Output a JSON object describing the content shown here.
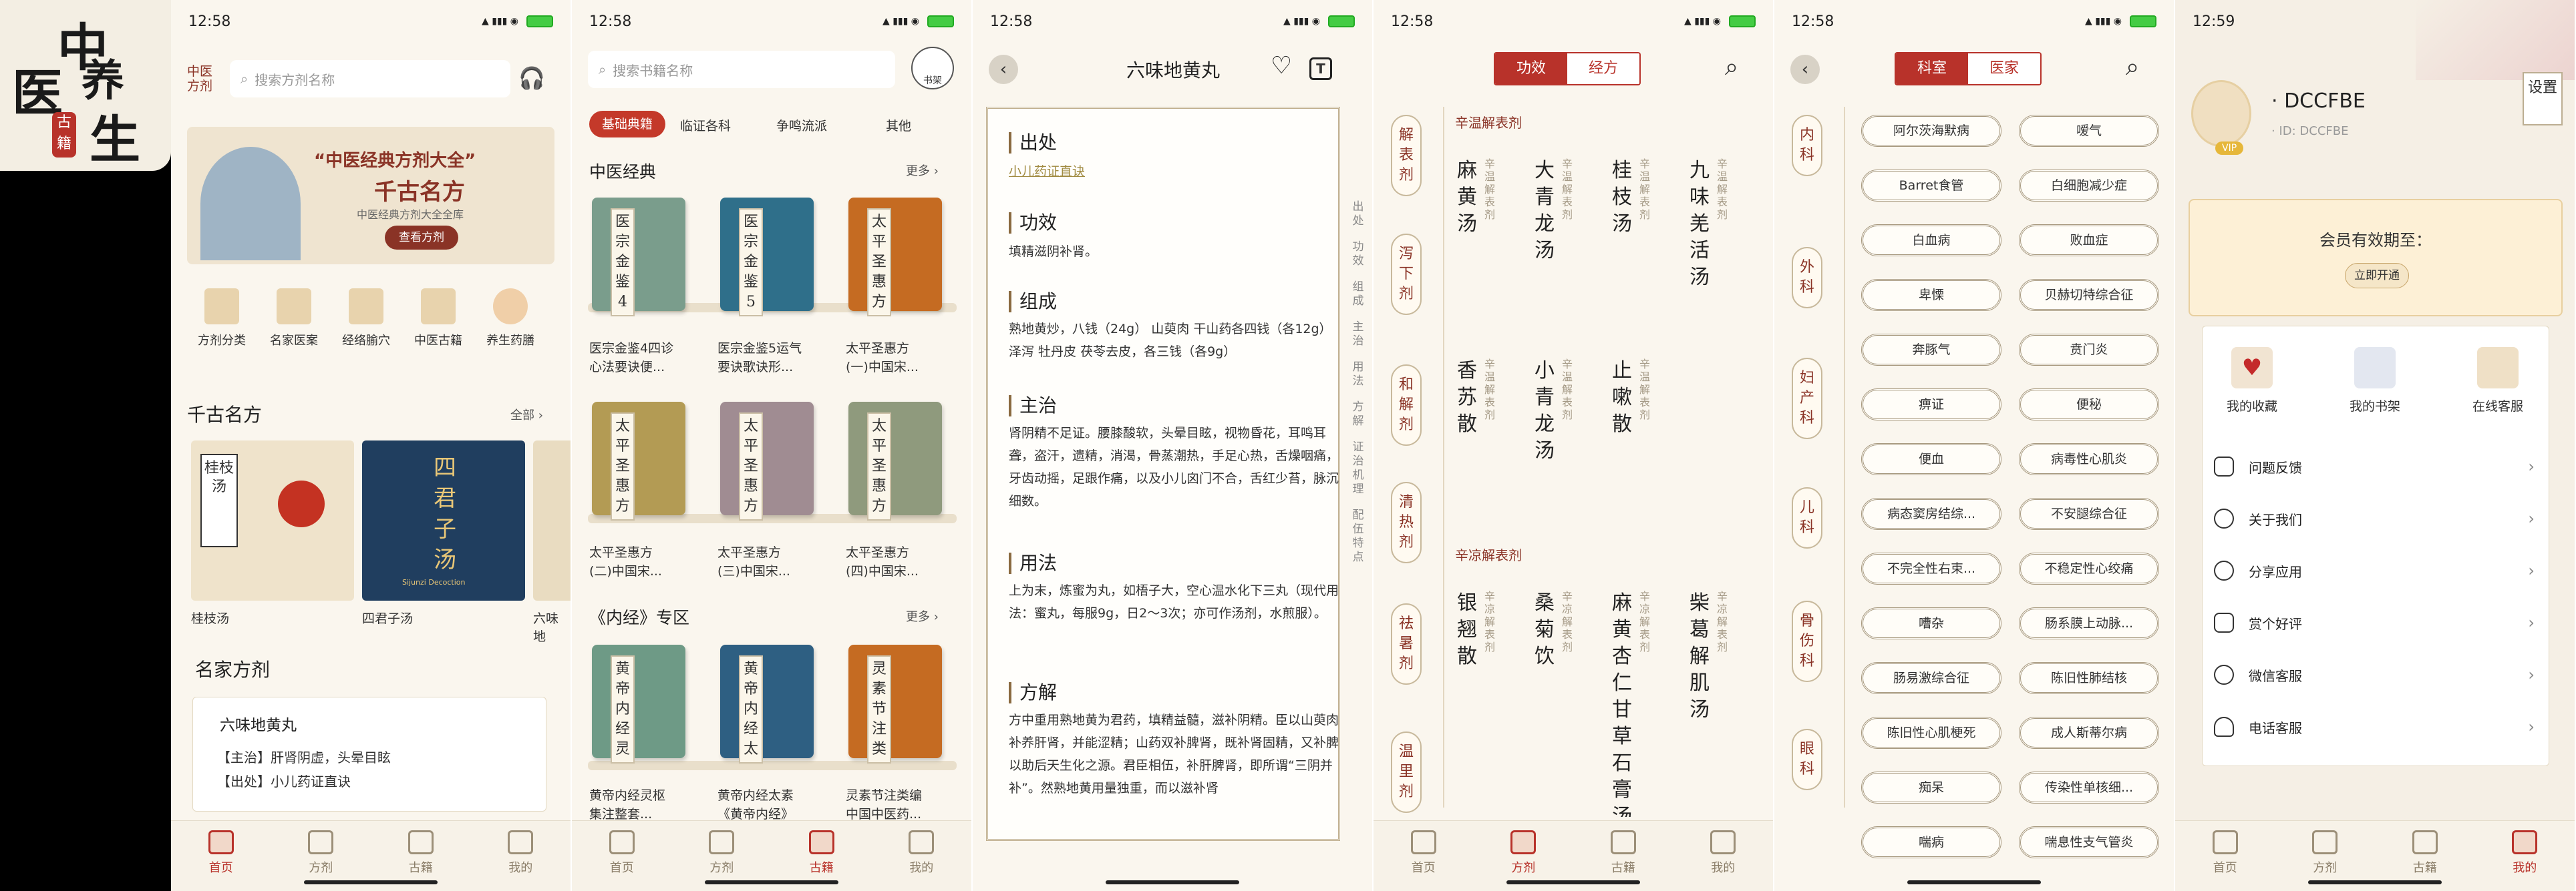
{
  "logo": {
    "big1": "中",
    "big2": "医",
    "big3": "养",
    "big4": "生",
    "stamp": "古籍"
  },
  "screens": [
    {
      "time": "12:58"
    },
    {
      "time": "12:58"
    },
    {
      "time": "12:58"
    },
    {
      "time": "12:58"
    },
    {
      "time": "12:58"
    },
    {
      "time": "12:59"
    }
  ],
  "tabs": [
    "首页",
    "方剂",
    "古籍",
    "我的"
  ],
  "home": {
    "brand": "中医方剂",
    "search_ph": "搜索方剂名称",
    "banner_title": "“中医经典方剂大全”",
    "banner_sub": "千古名方",
    "banner_desc": "中医经典方剂大全全库",
    "banner_btn": "查看方剂",
    "quick": [
      "方剂分类",
      "名家医案",
      "经络腧穴",
      "中医古籍",
      "养生药膳"
    ],
    "famous_title": "千古名方",
    "famous_more": "全部 ›",
    "famous": [
      {
        "name": "桂枝汤",
        "art": "桂枝汤"
      },
      {
        "name": "四君子汤",
        "art": "四君子汤",
        "art_en": "Sijunzi Decoction"
      },
      {
        "name": "六味地"
      }
    ],
    "master_title": "名家方剂",
    "master_card": {
      "name": "六味地黄丸",
      "line1": "【主治】肝肾阴虚，头晕目眩",
      "line2": "【出处】小儿药证直诀"
    }
  },
  "library": {
    "search_ph": "搜索书籍名称",
    "shelf_label": "书架",
    "chips": [
      "基础典籍",
      "临证各科",
      "争鸣流派",
      "其他"
    ],
    "sec1": "中医经典",
    "more": "更多 ›",
    "books1": [
      {
        "lbl": "医宗金鉴4",
        "cap1": "医宗金鉴4四诊",
        "cap2": "心法要诀便...",
        "color": "#7a9d8c"
      },
      {
        "lbl": "医宗金鉴5",
        "cap1": "医宗金鉴5运气",
        "cap2": "要诀歌诀形...",
        "color": "#2f6f8a"
      },
      {
        "lbl": "太平圣惠方",
        "cap1": "太平圣惠方",
        "cap2": "(一)中国宋...",
        "color": "#c56b22"
      }
    ],
    "books2": [
      {
        "lbl": "太平圣惠方",
        "cap1": "太平圣惠方",
        "cap2": "(二)中国宋...",
        "color": "#b39b54"
      },
      {
        "lbl": "太平圣惠方",
        "cap1": "太平圣惠方",
        "cap2": "(三)中国宋...",
        "color": "#a08c92"
      },
      {
        "lbl": "太平圣惠方",
        "cap1": "太平圣惠方",
        "cap2": "(四)中国宋...",
        "color": "#8f9a7d"
      }
    ],
    "sec2": "《内经》专区",
    "books3": [
      {
        "lbl": "黄帝内经灵",
        "cap1": "黄帝内经灵枢",
        "cap2": "集注整套...",
        "color": "#6e9a86"
      },
      {
        "lbl": "黄帝内经太",
        "cap1": "黄帝内经太素",
        "cap2": "《黄帝内经》",
        "color": "#2e5f82"
      },
      {
        "lbl": "灵素节注类",
        "cap1": "灵素节注类编",
        "cap2": "中国中医药...",
        "color": "#c56b22"
      }
    ]
  },
  "detail": {
    "title": "六味地黄丸",
    "h1": "出处",
    "p1": "小儿药证直诀",
    "h2": "功效",
    "p2": "填精滋阴补肾。",
    "h3": "组成",
    "p3": "熟地黄炒，八钱（24g） 山萸肉 干山药各四钱（各12g） 泽泻 牡丹皮 茯苓去皮，各三钱（各9g）",
    "h4": "主治",
    "p4": "肾阴精不足证。腰膝酸软，头晕目眩，视物昏花，耳鸣耳聋，盗汗，遗精，消渴，骨蒸潮热，手足心热，舌燥咽痛，牙齿动摇，足跟作痛，以及小儿囟门不合，舌红少苔，脉沉细数。",
    "h5": "用法",
    "p5": "上为末，炼蜜为丸，如梧子大，空心温水化下三丸（现代用法：蜜丸，每服9g，日2～3次；亦可作汤剂，水煎服）。",
    "h6": "方解",
    "p6": "方中重用熟地黄为君药，填精益髓，滋补阴精。臣以山萸肉补养肝肾，并能涩精；山药双补脾肾，既补肾固精，又补脾以助后天生化之源。君臣相伍，补肝脾肾，即所谓“三阴并补”。然熟地黄用量独重，而以滋补肾",
    "side": [
      "出处",
      "功效",
      "组成",
      "主治",
      "用法",
      "方解",
      "证治机理",
      "配伍特点"
    ]
  },
  "efficacy": {
    "seg": [
      "功效",
      "经方"
    ],
    "side": [
      "解表剂",
      "泻下剂",
      "和解剂",
      "清热剂",
      "祛暑剂",
      "温里剂"
    ],
    "g1": "辛温解表剂",
    "row1": [
      {
        "n": "麻黄汤",
        "t": "辛温解表剂"
      },
      {
        "n": "大青龙汤",
        "t": "辛温解表剂"
      },
      {
        "n": "桂枝汤",
        "t": "辛温解表剂"
      },
      {
        "n": "九味羌活汤",
        "t": "辛温解表剂"
      }
    ],
    "row2": [
      {
        "n": "香苏散",
        "t": "辛温解表剂"
      },
      {
        "n": "小青龙汤",
        "t": "辛温解表剂"
      },
      {
        "n": "止嗽散",
        "t": "辛温解表剂"
      }
    ],
    "g2": "辛凉解表剂",
    "row3": [
      {
        "n": "银翘散",
        "t": "辛凉解表剂"
      },
      {
        "n": "桑菊饮",
        "t": "辛凉解表剂"
      },
      {
        "n": "麻黄杏仁甘草石膏汤",
        "t": "辛凉解表剂"
      },
      {
        "n": "柴葛解肌汤",
        "t": "辛凉解表剂"
      }
    ]
  },
  "dept": {
    "seg": [
      "科室",
      "医家"
    ],
    "side": [
      "内科",
      "外科",
      "妇产科",
      "儿科",
      "骨伤科",
      "眼科"
    ],
    "items": [
      "阿尔茨海默病",
      "嗳气",
      "Barret食管",
      "白细胞减少症",
      "白血病",
      "败血症",
      "卑慄",
      "贝赫切特综合征",
      "奔豚气",
      "贲门炎",
      "痹证",
      "便秘",
      "便血",
      "病毒性心肌炎",
      "病态窦房结综...",
      "不安腿综合征",
      "不完全性右束...",
      "不稳定性心绞痛",
      "嘈杂",
      "肠系膜上动脉...",
      "肠易激综合征",
      "陈旧性肺结核",
      "陈旧性心肌梗死",
      "成人斯蒂尔病",
      "痴呆",
      "传染性单核细...",
      "喘病",
      "喘息性支气管炎"
    ]
  },
  "profile": {
    "username": "DCCFBE",
    "uid": "ID: DCCFBE",
    "vip": "VIP",
    "settings": "设置",
    "member_title": "会员有效期至：",
    "member_btn": "立即开通",
    "grid": [
      "我的收藏",
      "我的书架",
      "在线客服"
    ],
    "menu": [
      "问题反馈",
      "关于我们",
      "分享应用",
      "赏个好评",
      "微信客服",
      "电话客服"
    ]
  }
}
